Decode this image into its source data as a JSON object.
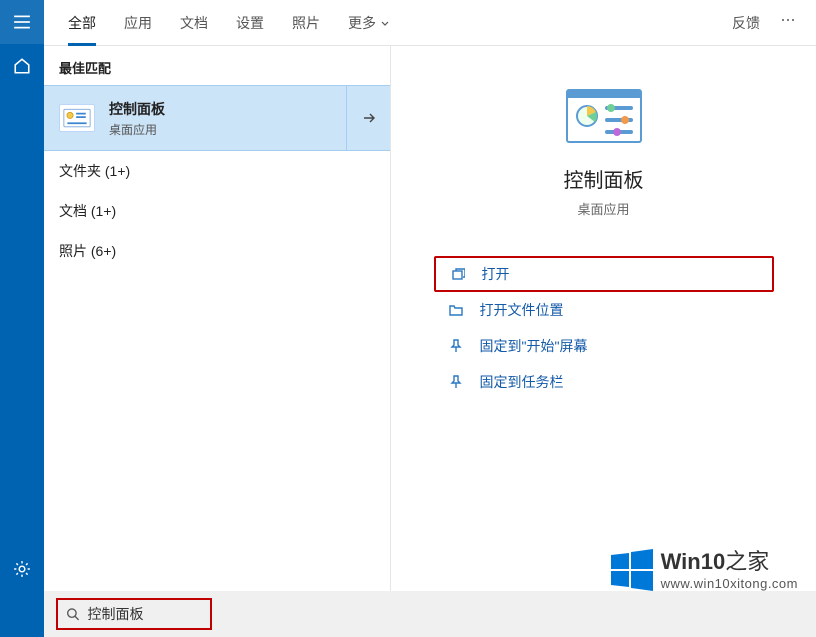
{
  "tabs": {
    "all": "全部",
    "apps": "应用",
    "docs": "文档",
    "settings": "设置",
    "photos": "照片",
    "more": "更多",
    "feedback": "反馈"
  },
  "results": {
    "best_match_header": "最佳匹配",
    "top": {
      "title": "控制面板",
      "subtitle": "桌面应用"
    },
    "groups": {
      "folders": "文件夹 (1+)",
      "documents": "文档 (1+)",
      "photos": "照片 (6+)"
    }
  },
  "preview": {
    "title": "控制面板",
    "subtitle": "桌面应用",
    "actions": {
      "open": "打开",
      "open_location": "打开文件位置",
      "pin_start": "固定到\"开始\"屏幕",
      "pin_taskbar": "固定到任务栏"
    }
  },
  "search": {
    "value": "控制面板"
  },
  "watermark": {
    "brand": "Win10",
    "suffix": "之家",
    "url": "www.win10xitong.com"
  }
}
